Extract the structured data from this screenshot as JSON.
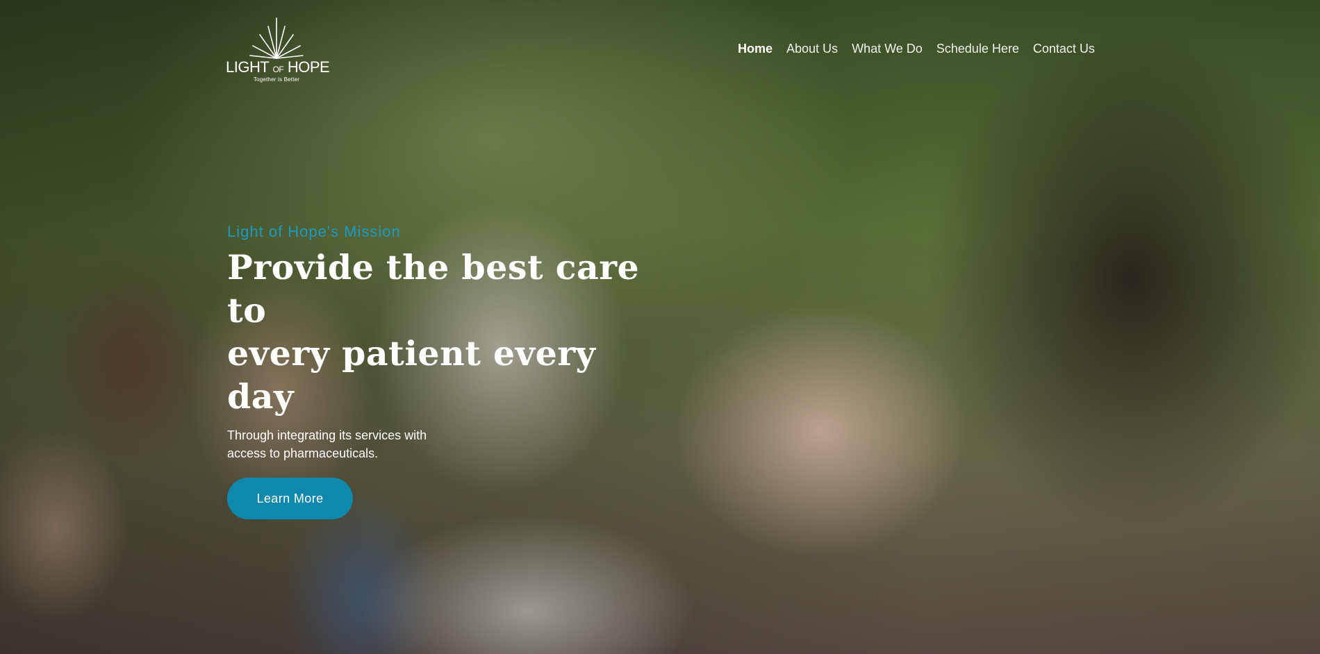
{
  "logo": {
    "name_main_1": "LIGHT",
    "name_of": "OF",
    "name_main_2": "HOPE",
    "tagline": "Together is Better"
  },
  "nav": {
    "items": [
      {
        "label": "Home"
      },
      {
        "label": "About Us"
      },
      {
        "label": "What We Do"
      },
      {
        "label": "Schedule Here"
      },
      {
        "label": "Contact Us"
      }
    ],
    "active": "Home"
  },
  "hero": {
    "eyebrow": "Light of Hope's Mission",
    "headline_line1": "Provide the best care to",
    "headline_line2": "every patient every day",
    "lede_line1": "Through integrating its services with",
    "lede_line2": "access to pharmaceuticals.",
    "cta_label": "Learn More",
    "background_image": "photo of a smiling diverse group of people outdoors"
  },
  "colors": {
    "accent": "#1a9bc4",
    "button": "#0f88ad",
    "text": "#ffffff"
  }
}
